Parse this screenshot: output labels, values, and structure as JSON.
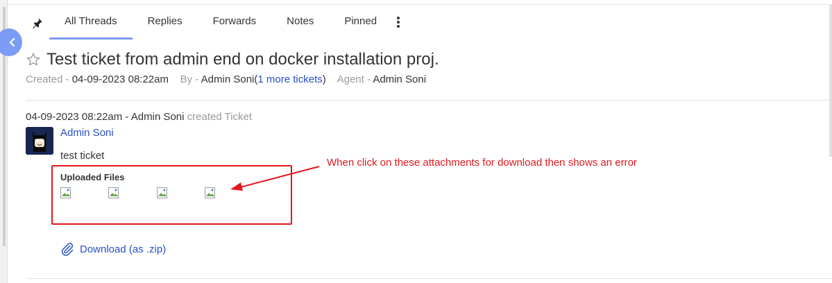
{
  "tabs": [
    {
      "label": "All Threads",
      "active": true
    },
    {
      "label": "Replies"
    },
    {
      "label": "Forwards"
    },
    {
      "label": "Notes"
    },
    {
      "label": "Pinned"
    }
  ],
  "ticket": {
    "title": "Test ticket from admin end on docker installation proj.",
    "created_label": "Created -",
    "created_value": "04-09-2023 08:22am",
    "by_label": "By -",
    "by_value": "Admin Soni",
    "more_open": "(",
    "more_link": "1 more tickets",
    "more_close": ")",
    "agent_label": "Agent -",
    "agent_value": "Admin Soni"
  },
  "thread": {
    "event_main": "04-09-2023 08:22am - Admin Soni",
    "event_action": "created Ticket",
    "user_name": "Admin Soni",
    "body": "test ticket",
    "files_title": "Uploaded Files",
    "download_label": "Download (as .zip)"
  },
  "annotation": {
    "text": "When click on these attachments for download then shows an error",
    "color": "#e3161b"
  },
  "colors": {
    "accent": "#7b9cf5",
    "link": "#2750c4"
  }
}
